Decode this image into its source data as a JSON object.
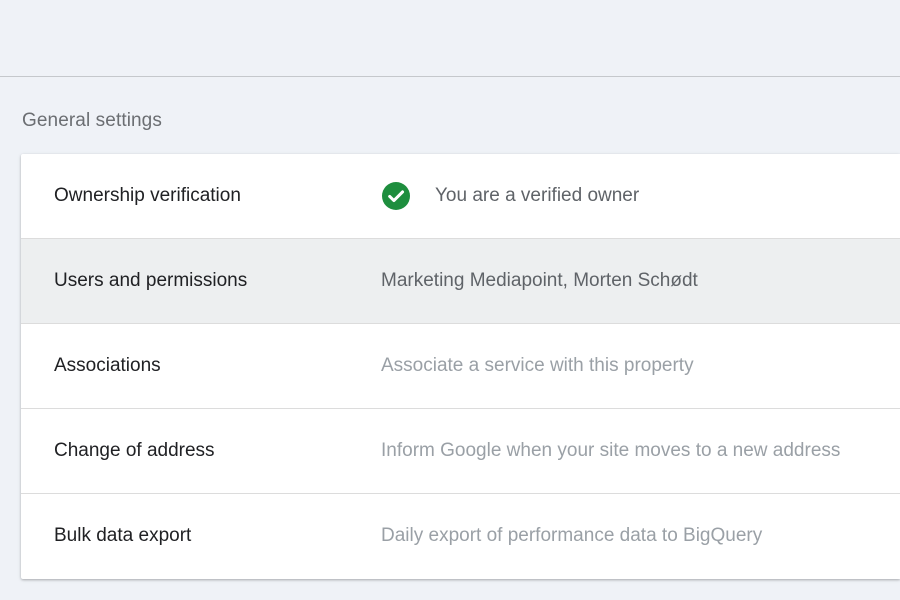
{
  "section": {
    "title": "General settings"
  },
  "rows": [
    {
      "label": "Ownership verification",
      "value": "You are a verified owner",
      "icon": "check-circle-icon",
      "icon_color": "#1e8e3e"
    },
    {
      "label": "Users and permissions",
      "value": "Marketing Mediapoint, Morten Schødt"
    },
    {
      "label": "Associations",
      "value": "Associate a service with this property"
    },
    {
      "label": "Change of address",
      "value": "Inform Google when your site moves to a new address"
    },
    {
      "label": "Bulk data export",
      "value": "Daily export of performance data to BigQuery"
    }
  ],
  "colors": {
    "background": "#eff2f7",
    "card": "#ffffff",
    "selected_row": "#edeff0",
    "verified_green": "#1e8e3e"
  }
}
